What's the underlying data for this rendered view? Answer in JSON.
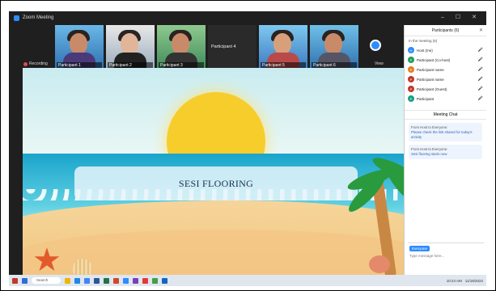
{
  "window": {
    "title": "Zoom Meeting",
    "controls": "– ☐ ✕"
  },
  "video_strip": {
    "tiles": [
      {
        "name": "Participant 1"
      },
      {
        "name": "Participant 2"
      },
      {
        "name": "Participant 3"
      },
      {
        "name": "Participant 4"
      },
      {
        "name": "Participant 5"
      },
      {
        "name": "Participant 6"
      }
    ],
    "recording_label": "Recording",
    "view_label": "View"
  },
  "shared_screen": {
    "banner_text": "SESI FLOORING"
  },
  "participants_panel": {
    "title": "Participants (6)",
    "section_label": "In the meeting (6)",
    "items": [
      {
        "name": "Host (me)",
        "color": "#2d8cff",
        "initial": "H"
      },
      {
        "name": "Participant (Co-host)",
        "color": "#1f9e5a",
        "initial": "P"
      },
      {
        "name": "Participant name",
        "color": "#e67e22",
        "initial": "P"
      },
      {
        "name": "Participant name",
        "color": "#c0392b",
        "initial": "P"
      },
      {
        "name": "Participant (Guest)",
        "color": "#c0392b",
        "initial": "P"
      },
      {
        "name": "Participant",
        "color": "#16a085",
        "initial": "P"
      }
    ]
  },
  "chat_panel": {
    "title": "Meeting Chat",
    "messages": [
      {
        "who": "From Host to Everyone:",
        "text": "Please check the link shared for today's activity"
      },
      {
        "who": "From Host to Everyone:",
        "text": "Sesi flooring starts now"
      }
    ],
    "to_label": "Everyone",
    "placeholder": "Type message here..."
  },
  "taskbar": {
    "search_placeholder": "Search",
    "time": "10:24 AM",
    "date": "11/18/2022"
  }
}
